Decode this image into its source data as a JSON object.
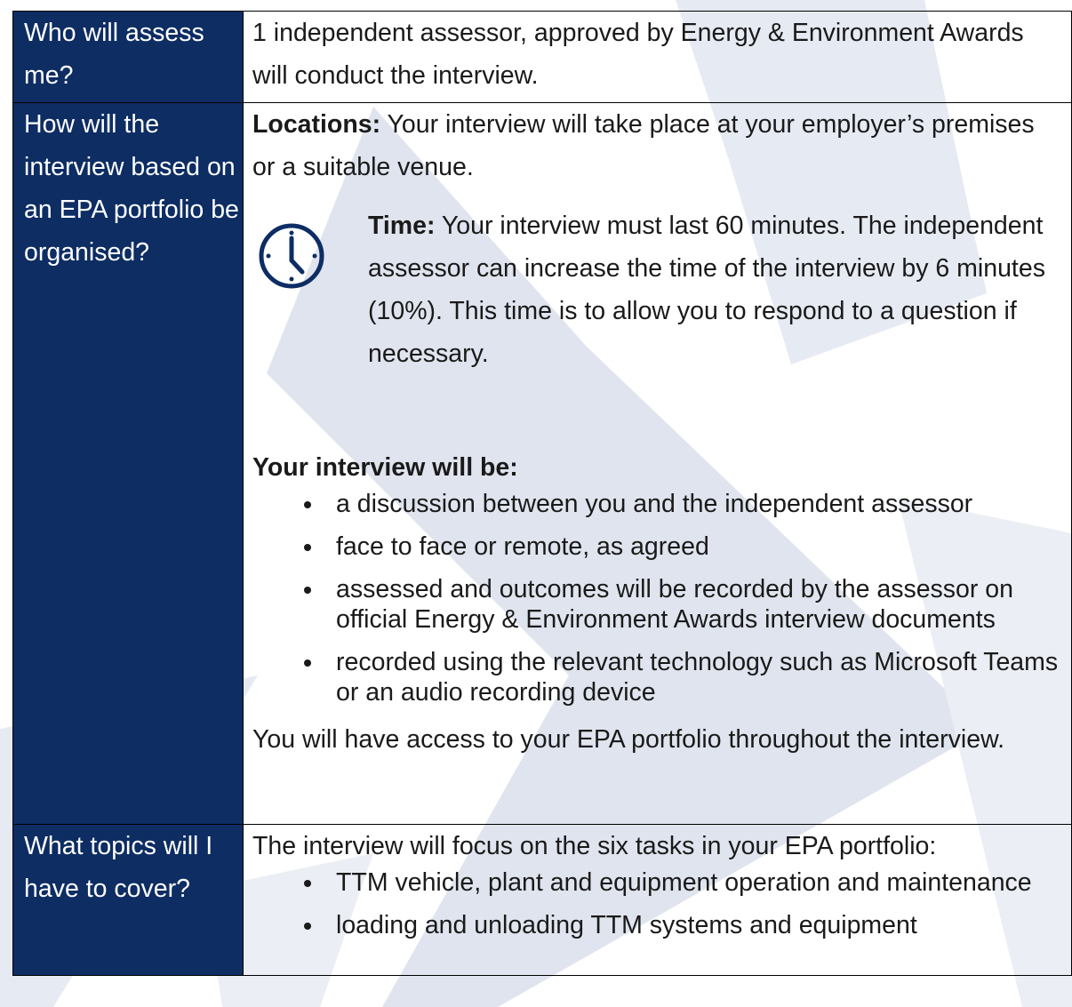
{
  "rows": [
    {
      "label": "Who will assess me?",
      "text": "1 independent assessor, approved by Energy & Environment Awards will conduct the interview."
    },
    {
      "label": "How will the interview based on an EPA portfolio be organised?",
      "locations_heading": "Locations:",
      "locations_text": " Your interview will take place at your employer’s premises or a suitable venue.",
      "time_heading": "Time:",
      "time_text": " Your interview must last 60 minutes. The independent assessor can increase the time of the interview by 6 minutes (10%). This time is to allow you to respond to a question if necessary.",
      "clock_icon": "clock-icon",
      "interview_heading": "Your interview will be:",
      "bullets": [
        "a discussion between you and the independent assessor",
        "face to face or remote, as agreed",
        "assessed and outcomes will be recorded by the assessor on official Energy & Environment Awards interview documents",
        "recorded using the relevant technology such as Microsoft Teams or an audio recording device"
      ],
      "closing": "You will have access to your EPA portfolio throughout the interview."
    },
    {
      "label": "What topics will I have to cover?",
      "intro": "The interview will focus on the six tasks in your EPA portfolio:",
      "bullets": [
        "TTM vehicle, plant and equipment operation and maintenance",
        "loading and unloading TTM systems and equipment"
      ]
    }
  ],
  "colors": {
    "label_bg": "#0d2d63",
    "label_text": "#ffffff",
    "watermark": "#dfe4ee",
    "clock": "#0d2d63"
  }
}
